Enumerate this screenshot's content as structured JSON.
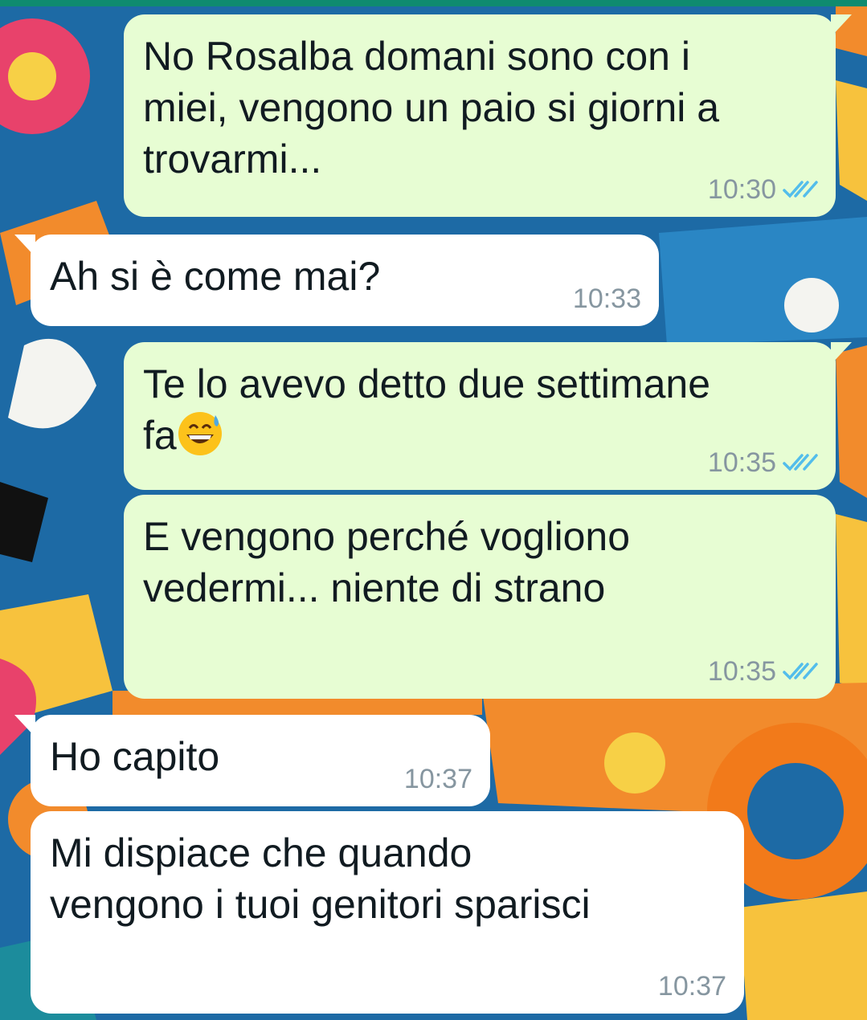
{
  "colors": {
    "outgoing_bubble": "#e7fdd3",
    "incoming_bubble": "#ffffff",
    "timestamp": "#8696a0",
    "read_ticks": "#53bdeb",
    "text": "#111b21"
  },
  "messages": [
    {
      "direction": "outgoing",
      "text": "No Rosalba domani sono con i\nmiei, vengono un paio si giorni a\ntrovarmi...",
      "time": "10:30",
      "status_icon": "double-check-read-icon"
    },
    {
      "direction": "incoming",
      "text": "Ah si è come mai?",
      "time": "10:33"
    },
    {
      "direction": "outgoing",
      "text": "Te lo avevo detto due settimane\nfa",
      "emoji": "grinning-face-with-sweat-emoji",
      "time": "10:35",
      "status_icon": "double-check-read-icon"
    },
    {
      "direction": "outgoing",
      "text": "E vengono perché vogliono\nvedermi... niente di strano",
      "time": "10:35",
      "status_icon": "double-check-read-icon"
    },
    {
      "direction": "incoming",
      "text": "Ho capito",
      "time": "10:37"
    },
    {
      "direction": "incoming",
      "text": "Mi dispiace che quando\nvengono i tuoi genitori sparisci",
      "time": "10:37"
    }
  ]
}
